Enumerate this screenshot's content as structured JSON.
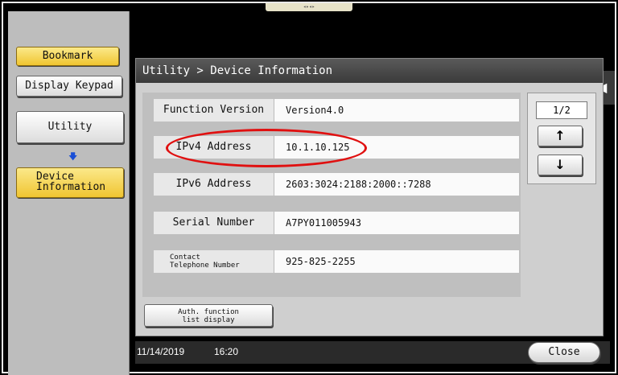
{
  "sidebar": {
    "bookmark": "Bookmark",
    "display_keypad": "Display Keypad",
    "utility": "Utility",
    "flow_arrow": "🡇",
    "device_information": "Device\nInformation"
  },
  "panel": {
    "title": "Utility > Device Information",
    "rows": [
      {
        "label": "Function Version",
        "value": "Version4.0"
      },
      {
        "label": "IPv4 Address",
        "value": "10.1.10.125"
      },
      {
        "label": "IPv6 Address",
        "value": "2603:3024:2188:2000::7288"
      },
      {
        "label": "Serial Number",
        "value": "A7PY011005943"
      },
      {
        "label": "Contact\nTelephone Number",
        "value": "925-825-2255"
      }
    ],
    "pager": {
      "indicator": "1/2",
      "up": "↑",
      "down": "↓"
    },
    "collapse": "◀◀",
    "auth_button": "Auth. function\nlist display"
  },
  "status": {
    "date": "11/14/2019",
    "time": "16:20",
    "close": "Close"
  },
  "colors": {
    "accent_yellow": "#f0c531",
    "annotation": "#e01010"
  }
}
